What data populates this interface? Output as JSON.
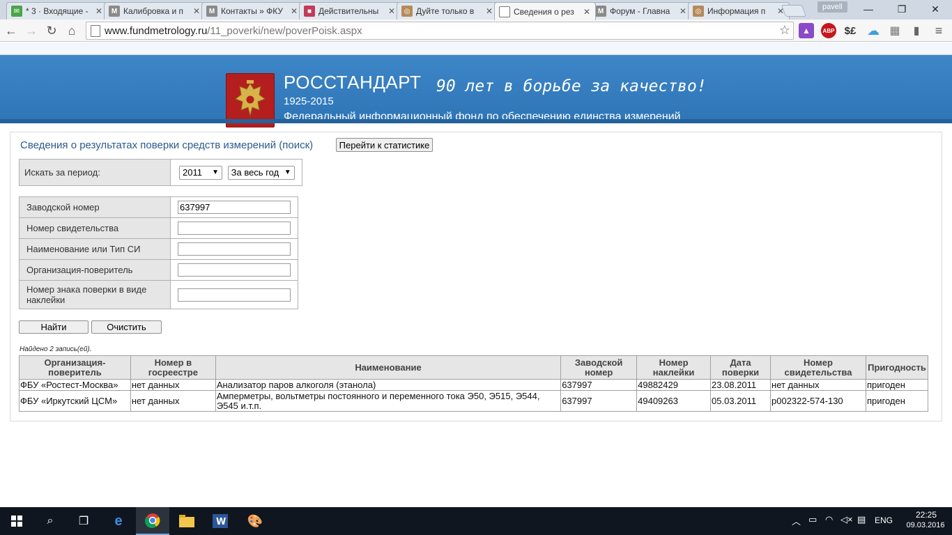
{
  "browser": {
    "tabs": [
      {
        "title": "* 3 · Входящие -",
        "fav": "#4aa54a",
        "favtext": "✉"
      },
      {
        "title": "Калибровка и п",
        "fav": "#8a8a8a",
        "favtext": "M"
      },
      {
        "title": "Контакты » ФКУ",
        "fav": "#8a8a8a",
        "favtext": "M"
      },
      {
        "title": "Действительны",
        "fav": "#c23a5c",
        "favtext": "■"
      },
      {
        "title": "Дуйте только в",
        "fav": "#b58a5a",
        "favtext": "◎"
      },
      {
        "title": "Сведения о рез",
        "fav": "#ffffff",
        "favtext": ""
      },
      {
        "title": "Форум - Главна",
        "fav": "#8a8a8a",
        "favtext": "M"
      },
      {
        "title": "Информация п",
        "fav": "#b58a5a",
        "favtext": "◎"
      }
    ],
    "profile": "pavell",
    "url_host": "www.fundmetrology.ru",
    "url_path": "/11_poverki/new/poverPoisk.aspx",
    "extensions": [
      {
        "name": "purple-ext-icon",
        "label": "▲",
        "color": "#8a4ac9"
      },
      {
        "name": "adblock-icon",
        "label": "ABP",
        "color": "#c4161c"
      },
      {
        "name": "currency-ext-icon",
        "label": "$£",
        "color": "#f6f6f6"
      },
      {
        "name": "cloud-ext-icon",
        "label": "☁",
        "color": "#f6f6f6"
      },
      {
        "name": "puzzle-ext-icon",
        "label": "▦",
        "color": "#f6f6f6"
      },
      {
        "name": "bookmark-ext-icon",
        "label": "▮",
        "color": "#f6f6f6"
      }
    ]
  },
  "banner": {
    "title": "РОССТАНДАРТ",
    "years": "1925-2015",
    "slogan": "90 лет в борьбе за качество!",
    "subtitle": "Федеральный информационный фонд по обеспечению единства измерений"
  },
  "page": {
    "title": "Сведения о результатах поверки средств измерений (поиск)",
    "stats_button": "Перейти к статистике",
    "period_label": "Искать за период:",
    "year": "2011",
    "period": "За весь год",
    "fields": [
      {
        "label": "Заводской номер",
        "value": "637997"
      },
      {
        "label": "Номер свидетельства",
        "value": ""
      },
      {
        "label": "Наименование или Тип СИ",
        "value": ""
      },
      {
        "label": "Организация-поверитель",
        "value": ""
      },
      {
        "label": "Номер знака поверки в виде наклейки",
        "value": ""
      }
    ],
    "find_button": "Найти",
    "clear_button": "Очистить",
    "found_text": "Найдено 2 запись(ей)."
  },
  "results": {
    "headers": [
      "Организация-поверитель",
      "Номер в госреестре",
      "Наименование",
      "Заводской номер",
      "Номер наклейки",
      "Дата поверки",
      "Номер свидетельства",
      "Пригодность"
    ],
    "rows": [
      [
        "ФБУ «Ростест-Москва»",
        "нет данных",
        "Анализатор паров алкоголя (этанола)",
        "637997",
        "49882429",
        "23.08.2011",
        "нет данных",
        "пригоден"
      ],
      [
        "ФБУ «Иркутский ЦСМ»",
        "нет данных",
        "Амперметры, вольтметры постоянного и переменного тока Э50, Э515, Э544, Э545 и.т.п.",
        "637997",
        "49409263",
        "05.03.2011",
        "р002322-574-130",
        "пригоден"
      ]
    ]
  },
  "taskbar": {
    "lang": "ENG",
    "time": "22:25",
    "date": "09.03.2016"
  }
}
